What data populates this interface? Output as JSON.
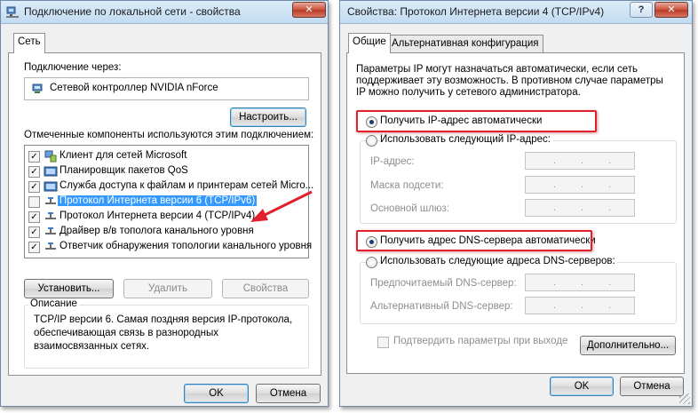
{
  "left_window": {
    "title": "Подключение по локальной сети - свойства",
    "close_glyph": "✕",
    "tab": "Сеть",
    "connect_using_label": "Подключение через:",
    "adapter_name": "Сетевой контроллер NVIDIA nForce",
    "configure_button": "Настроить...",
    "components_label": "Отмеченные компоненты используются этим подключением:",
    "components": [
      {
        "label": "Клиент для сетей Microsoft",
        "checked": true,
        "selected": false
      },
      {
        "label": "Планировщик пакетов QoS",
        "checked": true,
        "selected": false
      },
      {
        "label": "Служба доступа к файлам и принтерам сетей Micro...",
        "checked": true,
        "selected": false
      },
      {
        "label": "Протокол Интернета версии 6 (TCP/IPv6)",
        "checked": false,
        "selected": true
      },
      {
        "label": "Протокол Интернета версии 4 (TCP/IPv4)",
        "checked": true,
        "selected": false
      },
      {
        "label": "Драйвер в/в тополога канального уровня",
        "checked": true,
        "selected": false
      },
      {
        "label": "Ответчик обнаружения топологии канального уровня",
        "checked": true,
        "selected": false
      }
    ],
    "install_button": "Установить...",
    "uninstall_button": "Удалить",
    "properties_button": "Свойства",
    "description_title": "Описание",
    "description_text": [
      "TCP/IP версии 6. Самая поздняя версия IP-протокола,",
      "обеспечивающая связь в разнородных",
      "взаимосвязанных сетях."
    ],
    "ok_button": "OK",
    "cancel_button": "Отмена"
  },
  "right_window": {
    "title": "Свойства: Протокол Интернета версии 4 (TCP/IPv4)",
    "help_glyph": "?",
    "close_glyph": "✕",
    "tabs": [
      "Общие",
      "Альтернативная конфигурация"
    ],
    "intro_text": [
      "Параметры IP могут назначаться автоматически, если сеть",
      "поддерживает эту возможность. В противном случае параметры",
      "IP можно получить у сетевого администратора."
    ],
    "ip_auto_radio": "Получить IP-адрес автоматически",
    "ip_manual_radio": "Использовать следующий IP-адрес:",
    "ip_address_label": "IP-адрес:",
    "subnet_mask_label": "Маска подсети:",
    "gateway_label": "Основной шлюз:",
    "dns_auto_radio": "Получить адрес DNS-сервера автоматически",
    "dns_manual_radio": "Использовать следующие адреса DNS-серверов:",
    "preferred_dns_label": "Предпочитаемый DNS-сервер:",
    "alternate_dns_label": "Альтернативный DNS-сервер:",
    "validate_on_exit": "Подтвердить параметры при выходе",
    "advanced_button": "Дополнительно...",
    "ok_button": "OK",
    "cancel_button": "Отмена",
    "ip_dot": "."
  },
  "colors": {
    "annotation_red": "#e0202a",
    "selection_blue": "#3399ff"
  }
}
